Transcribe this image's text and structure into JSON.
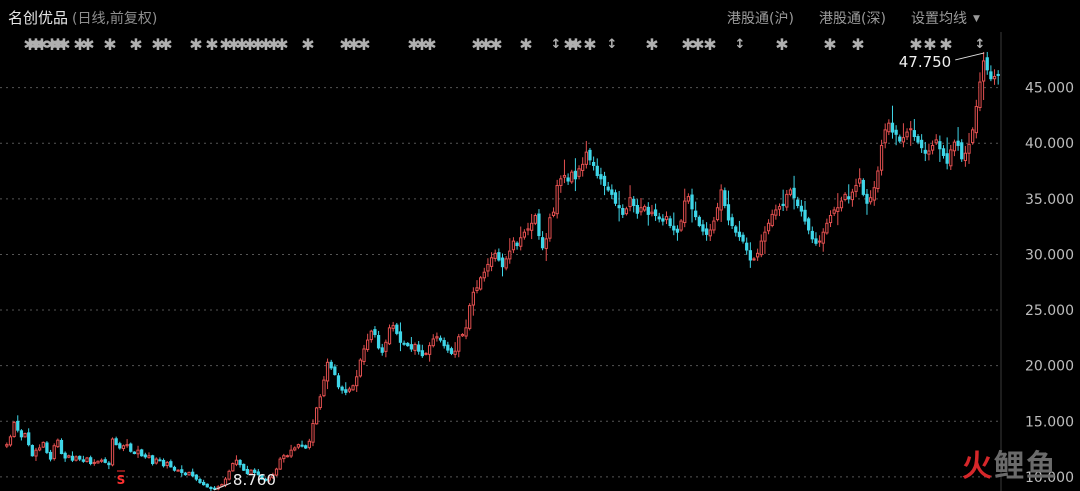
{
  "header": {
    "stock_name": "名创优品",
    "subtitle": "(日线,前复权)",
    "buttons": [
      "港股通(沪)",
      "港股通(深)",
      "设置均线"
    ]
  },
  "watermark": {
    "part1": "火",
    "part2": "鲤鱼"
  },
  "colors": {
    "up": "#e35050",
    "down": "#3fd6e8",
    "grid": "#555555",
    "axis_text": "#bdbdbd",
    "marker": "#b0b0b0",
    "s_marker": "#ff3030"
  },
  "chart_data": {
    "type": "candlestick",
    "title": "",
    "xlabel": "",
    "ylabel": "",
    "ylim": [
      9.0,
      50.0
    ],
    "yticks": [
      "10.000",
      "15.000",
      "20.000",
      "25.000",
      "30.000",
      "35.000",
      "40.000",
      "45.000"
    ],
    "grid": "horizontal-dotted",
    "annotations": [
      {
        "label": "47.750",
        "type": "high"
      },
      {
        "label": "8.760",
        "type": "low"
      }
    ],
    "event_markers": "rows of ✱ and ↕ symbols along the top",
    "s_marker": "S",
    "close_series": [
      12.9,
      13.6,
      14.9,
      14.2,
      13.6,
      13.9,
      12.9,
      11.9,
      12.4,
      12.6,
      13.1,
      12.2,
      11.6,
      12.8,
      13.3,
      12.1,
      11.7,
      11.9,
      11.5,
      11.8,
      11.6,
      11.4,
      11.7,
      11.2,
      11.3,
      11.4,
      11.5,
      11.3,
      11.1,
      13.4,
      12.9,
      12.6,
      12.8,
      12.9,
      12.3,
      12.1,
      12.4,
      11.9,
      11.8,
      11.9,
      11.2,
      11.6,
      11.5,
      11.0,
      11.3,
      10.9,
      10.6,
      10.6,
      10.4,
      10.2,
      10.4,
      10.1,
      9.8,
      9.5,
      9.3,
      9.1,
      9.0,
      8.9,
      9.1,
      9.3,
      9.8,
      10.5,
      11.2,
      11.5,
      11.1,
      10.6,
      10.3,
      10.6,
      10.4,
      10.2,
      9.8,
      9.7,
      9.9,
      10.2,
      10.7,
      11.6,
      11.9,
      11.9,
      12.4,
      12.6,
      12.9,
      12.8,
      12.6,
      13.2,
      14.8,
      16.2,
      17.2,
      18.7,
      20.3,
      19.8,
      19.2,
      18.1,
      17.8,
      17.6,
      17.9,
      18.2,
      19.0,
      20.5,
      21.5,
      22.3,
      23.1,
      22.8,
      21.6,
      21.2,
      22.1,
      23.4,
      23.6,
      22.9,
      22.1,
      22.0,
      21.8,
      21.5,
      21.9,
      21.3,
      20.9,
      21.1,
      21.8,
      22.4,
      22.6,
      22.3,
      21.8,
      21.4,
      21.1,
      21.3,
      22.6,
      22.8,
      23.4,
      25.4,
      26.6,
      27.0,
      27.9,
      28.4,
      29.1,
      29.7,
      30.1,
      29.5,
      28.9,
      29.6,
      30.3,
      31.2,
      30.8,
      31.5,
      32.0,
      32.3,
      32.8,
      33.5,
      31.7,
      30.6,
      31.4,
      33.3,
      33.8,
      36.2,
      36.8,
      37.1,
      36.6,
      37.4,
      36.8,
      37.7,
      38.1,
      39.2,
      38.5,
      38.0,
      37.1,
      36.8,
      36.2,
      35.8,
      35.4,
      34.6,
      34.2,
      33.6,
      34.1,
      35.1,
      34.4,
      33.7,
      34.2,
      34.3,
      33.6,
      33.8,
      33.5,
      33.2,
      33.0,
      33.4,
      32.6,
      32.2,
      32.0,
      33.0,
      34.8,
      35.2,
      34.1,
      33.4,
      32.6,
      32.1,
      31.8,
      32.2,
      33.0,
      34.2,
      35.8,
      34.4,
      33.1,
      32.6,
      32.0,
      31.6,
      31.2,
      30.4,
      29.5,
      29.6,
      30.1,
      31.2,
      32.0,
      32.8,
      33.6,
      34.0,
      34.3,
      34.4,
      35.4,
      35.8,
      35.1,
      34.4,
      33.9,
      33.0,
      32.2,
      31.4,
      31.0,
      31.2,
      32.0,
      32.8,
      33.5,
      34.0,
      34.2,
      34.8,
      35.4,
      35.0,
      35.6,
      36.2,
      36.8,
      35.4,
      34.6,
      35.1,
      36.0,
      37.5,
      39.8,
      41.2,
      41.8,
      41.0,
      40.8,
      40.2,
      40.5,
      41.0,
      41.3,
      40.6,
      40.1,
      39.6,
      39.1,
      39.3,
      39.8,
      40.3,
      39.5,
      38.9,
      38.2,
      39.4,
      40.1,
      39.8,
      38.6,
      39.1,
      39.9,
      41.2,
      43.3,
      45.5,
      47.4,
      46.6,
      45.8,
      46.0,
      46.1
    ]
  }
}
